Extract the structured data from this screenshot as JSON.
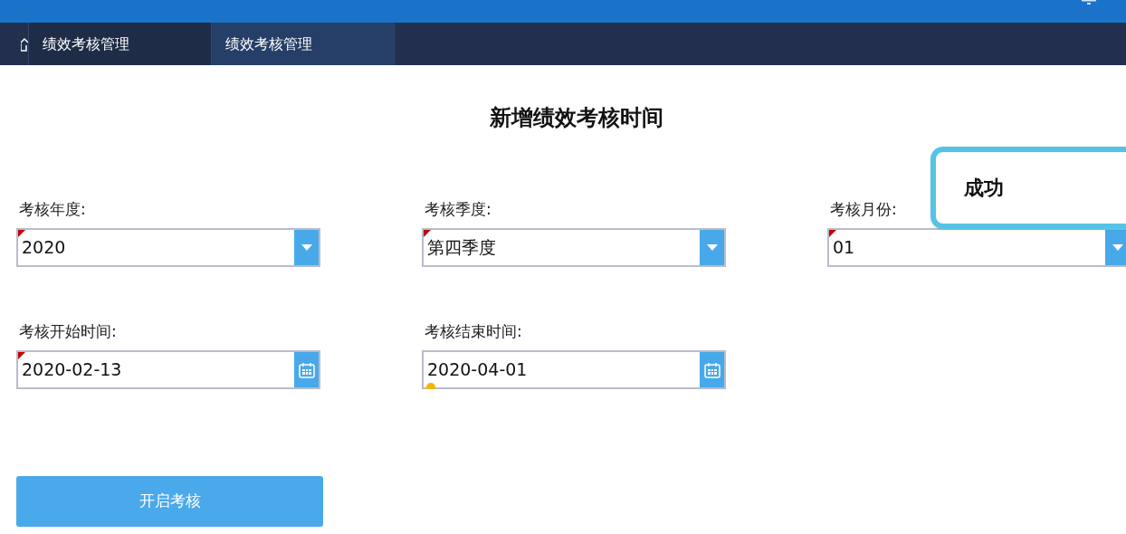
{
  "nav_tabs": [
    {
      "label": "绩效考核管理",
      "selected": false
    },
    {
      "label": "绩效考核管理",
      "selected": true
    }
  ],
  "title": "新增绩效考核时间",
  "fields": [
    {
      "kind": "select",
      "label": "考核年度:",
      "value": "2020",
      "required": true,
      "warning": false
    },
    {
      "kind": "select",
      "label": "考核季度:",
      "value": "第四季度",
      "required": true,
      "warning": false
    },
    {
      "kind": "select",
      "label": "考核月份:",
      "value": "01",
      "required": true,
      "warning": false
    },
    {
      "kind": "date",
      "label": "考核开始时间:",
      "value": "2020-02-13",
      "required": true,
      "warning": false
    },
    {
      "kind": "date",
      "label": "考核结束时间:",
      "value": "2020-04-01",
      "required": false,
      "warning": true
    }
  ],
  "submit_button": "开启考核",
  "toast": {
    "message": "成功"
  }
}
